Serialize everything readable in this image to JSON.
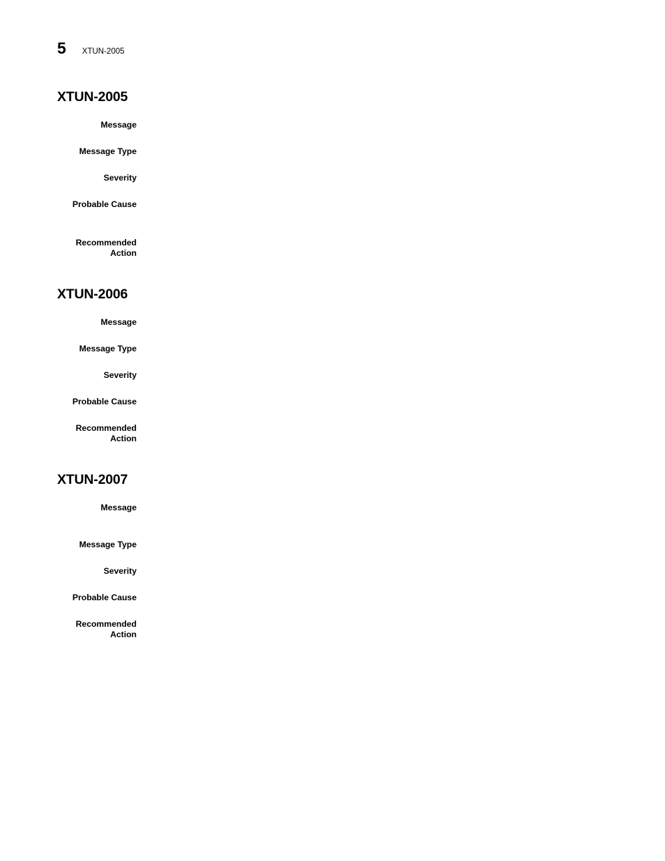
{
  "document": {
    "background_color": "#ffffff",
    "text_color": "#000000"
  },
  "running_header": {
    "page_number": "5",
    "title": "XTUN-2005"
  },
  "sections": [
    {
      "heading": "XTUN-2005",
      "fields": [
        {
          "label": "Message",
          "value": ""
        },
        {
          "label": "Message Type",
          "value": ""
        },
        {
          "label": "Severity",
          "value": ""
        },
        {
          "label": "Probable Cause",
          "value": ""
        },
        {
          "label": "Recommended\nAction",
          "value": ""
        }
      ]
    },
    {
      "heading": "XTUN-2006",
      "fields": [
        {
          "label": "Message",
          "value": ""
        },
        {
          "label": "Message Type",
          "value": ""
        },
        {
          "label": "Severity",
          "value": ""
        },
        {
          "label": "Probable Cause",
          "value": ""
        },
        {
          "label": "Recommended\nAction",
          "value": ""
        }
      ]
    },
    {
      "heading": "XTUN-2007",
      "fields": [
        {
          "label": "Message",
          "value": ""
        },
        {
          "label": "Message Type",
          "value": ""
        },
        {
          "label": "Severity",
          "value": ""
        },
        {
          "label": "Probable Cause",
          "value": ""
        },
        {
          "label": "Recommended\nAction",
          "value": ""
        }
      ]
    }
  ]
}
